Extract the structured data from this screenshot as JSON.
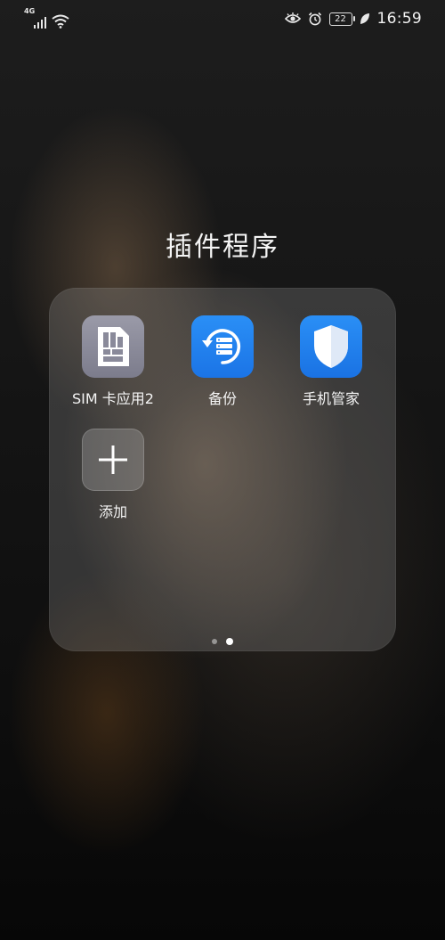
{
  "status_bar": {
    "network_type": "4G",
    "battery_level": "22",
    "time": "16:59",
    "icons": [
      "signal-icon",
      "wifi-icon",
      "eye-comfort-icon",
      "alarm-icon",
      "battery-icon",
      "power-saving-leaf-icon"
    ]
  },
  "folder": {
    "title": "插件程序",
    "apps": [
      {
        "label": "SIM 卡应用2",
        "icon": "sim-card-icon",
        "color": "#8a8a9a"
      },
      {
        "label": "备份",
        "icon": "backup-icon",
        "color": "#1f80ee"
      },
      {
        "label": "手机管家",
        "icon": "shield-icon",
        "color": "#1f80ee"
      },
      {
        "label": "添加",
        "icon": "plus-icon"
      }
    ],
    "pages": {
      "count": 2,
      "current": 2
    }
  }
}
